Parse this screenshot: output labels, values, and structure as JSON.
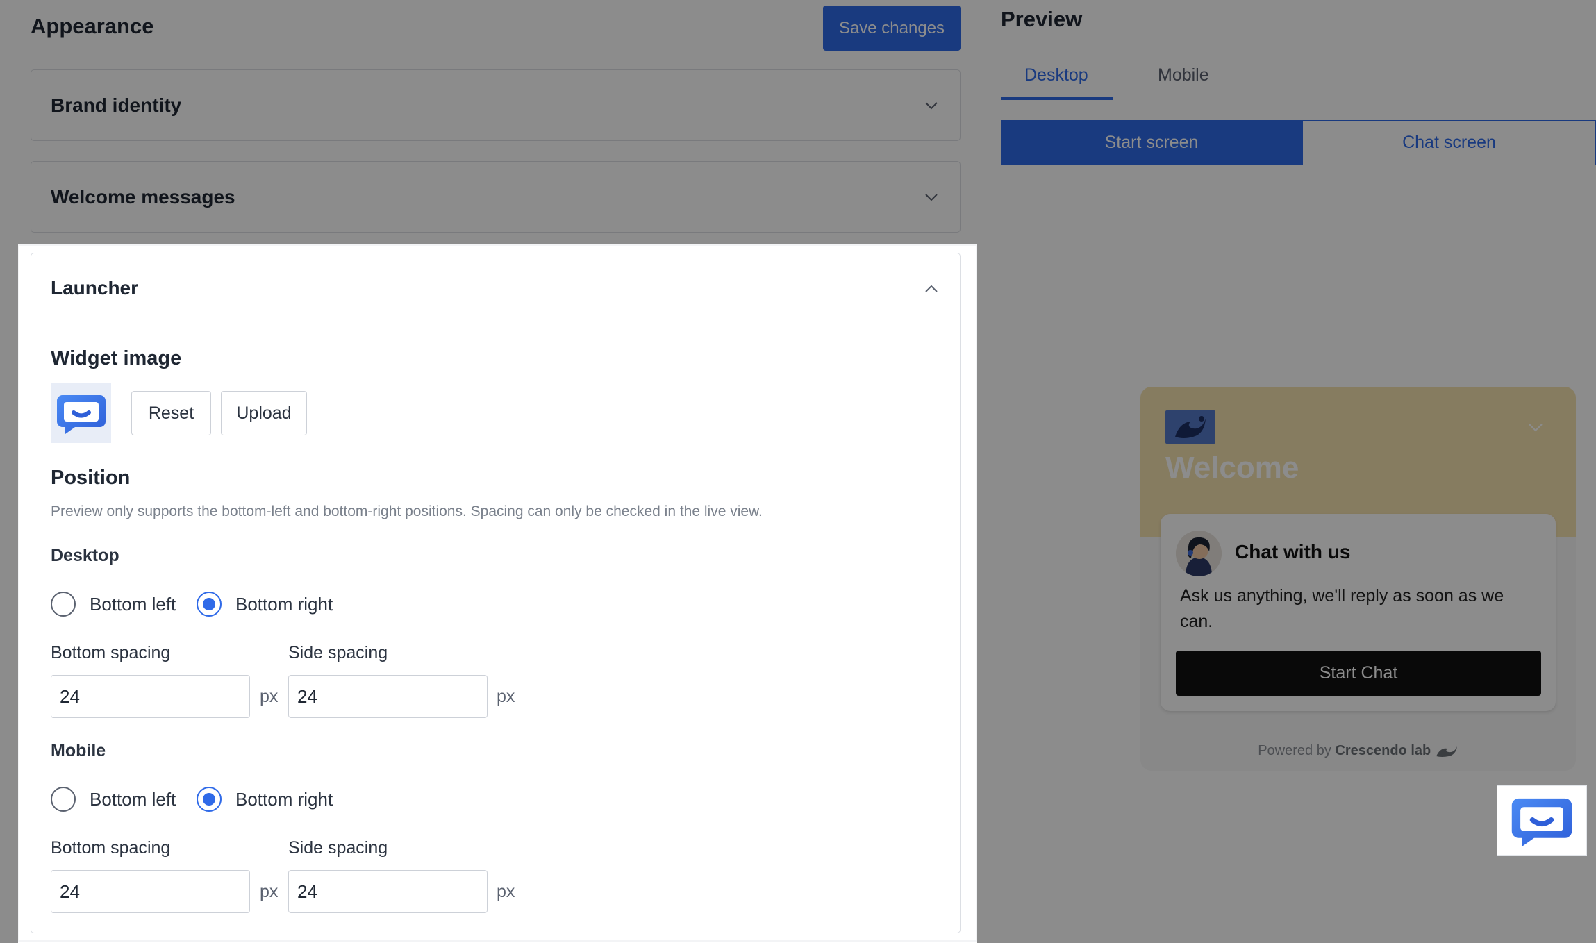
{
  "header": {
    "title": "Appearance",
    "save_label": "Save changes"
  },
  "sections": {
    "brand_identity": "Brand identity",
    "welcome_messages": "Welcome messages",
    "launcher": "Launcher"
  },
  "launcher": {
    "widget_image_title": "Widget image",
    "reset_label": "Reset",
    "upload_label": "Upload",
    "position_title": "Position",
    "position_hint": "Preview only supports the bottom-left and bottom-right positions. Spacing can only be checked in the live view.",
    "desktop": {
      "title": "Desktop",
      "option_left": "Bottom left",
      "option_right": "Bottom right",
      "selected": "Bottom right",
      "bottom_spacing_label": "Bottom spacing",
      "side_spacing_label": "Side spacing",
      "bottom_spacing": "24",
      "side_spacing": "24",
      "unit": "px"
    },
    "mobile": {
      "title": "Mobile",
      "option_left": "Bottom left",
      "option_right": "Bottom right",
      "selected": "Bottom right",
      "bottom_spacing_label": "Bottom spacing",
      "side_spacing_label": "Side spacing",
      "bottom_spacing": "24",
      "side_spacing": "24",
      "unit": "px"
    }
  },
  "preview": {
    "title": "Preview",
    "tabs": [
      {
        "label": "Desktop",
        "active": true
      },
      {
        "label": "Mobile",
        "active": false
      }
    ],
    "segments": [
      {
        "label": "Start screen",
        "active": true
      },
      {
        "label": "Chat screen",
        "active": false
      }
    ],
    "widget": {
      "welcome": "Welcome",
      "card_title": "Chat with us",
      "card_text": "Ask us anything, we'll reply as soon as we can.",
      "start_label": "Start Chat",
      "powered_prefix": "Powered by",
      "powered_brand": "Crescendo lab"
    }
  },
  "colors": {
    "accent": "#2f6ae8",
    "widget_header": "#f5e2b0",
    "start_button": "#111111",
    "overlay": "rgba(0,0,0,0.45)"
  },
  "icons": [
    "chevron-down-icon",
    "chevron-up-icon",
    "chat-bubble-icon",
    "brand-logo-icon",
    "agent-avatar",
    "crescendo-lab-logo"
  ]
}
